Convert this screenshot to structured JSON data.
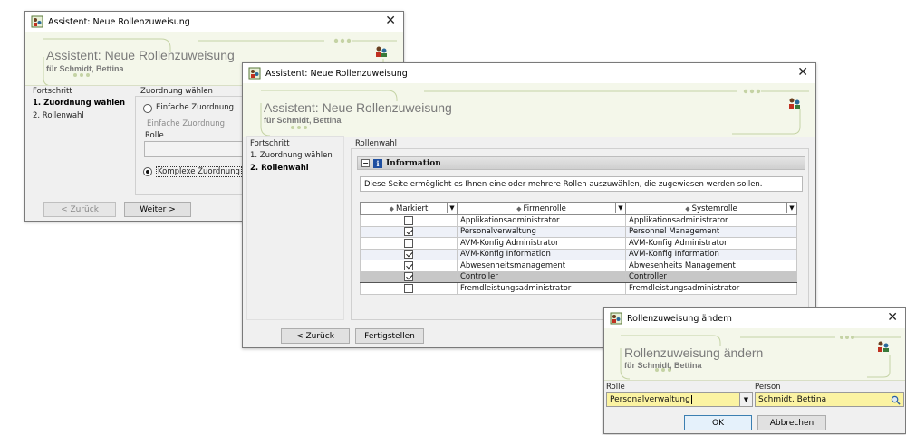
{
  "win1": {
    "title": "Assistent: Neue Rollenzuweisung",
    "banner_title": "Assistent: Neue Rollenzuweisung",
    "banner_subtitle": "für Schmidt, Bettina",
    "sidebar": {
      "title": "Fortschritt",
      "items": [
        {
          "label": "1. Zuordnung wählen"
        },
        {
          "label": "2. Rollenwahl"
        }
      ]
    },
    "group_title": "Zuordnung wählen",
    "radio_simple": "Einfache Zuordnung",
    "simple_group_title": "Einfache Zuordnung",
    "role_label": "Rolle",
    "radio_complex": "Komplexe Zuordnung",
    "back_button": "< Zurück",
    "next_button": "Weiter >"
  },
  "win2": {
    "title": "Assistent: Neue Rollenzuweisung",
    "banner_title": "Assistent: Neue Rollenzuweisung",
    "banner_subtitle": "für Schmidt, Bettina",
    "sidebar": {
      "title": "Fortschritt",
      "items": [
        {
          "label": "1. Zuordnung wählen"
        },
        {
          "label": "2. Rollenwahl"
        }
      ]
    },
    "section_title": "Rollenwahl",
    "info_header": "Information",
    "info_text": "Diese Seite ermöglicht es Ihnen eine oder mehrere Rollen auszuwählen, die zugewiesen werden sollen.",
    "table": {
      "columns": [
        "Markiert",
        "Firmenrolle",
        "Systemrolle"
      ],
      "rows": [
        {
          "checked": false,
          "firmenrolle": "Applikationsadministrator",
          "systemrolle": "Applikationsadministrator",
          "selected": false
        },
        {
          "checked": true,
          "firmenrolle": "Personalverwaltung",
          "systemrolle": "Personnel Management",
          "selected": false
        },
        {
          "checked": false,
          "firmenrolle": "AVM-Konfig Administrator",
          "systemrolle": "AVM-Konfig Administrator",
          "selected": false
        },
        {
          "checked": true,
          "firmenrolle": "AVM-Konfig Information",
          "systemrolle": "AVM-Konfig Information",
          "selected": false
        },
        {
          "checked": true,
          "firmenrolle": "Abwesenheitsmanagement",
          "systemrolle": "Abwesenheits Management",
          "selected": false
        },
        {
          "checked": true,
          "firmenrolle": "Controller",
          "systemrolle": "Controller",
          "selected": true
        },
        {
          "checked": false,
          "firmenrolle": "Fremdleistungsadministrator",
          "systemrolle": "Fremdleistungsadministrator",
          "selected": false
        }
      ]
    },
    "back_button": "< Zurück",
    "finish_button": "Fertigstellen"
  },
  "win3": {
    "title": "Rollenzuweisung ändern",
    "banner_title": "Rollenzuweisung ändern",
    "banner_subtitle": "für Schmidt, Bettina",
    "role_label": "Rolle",
    "role_value": "Personalverwaltung",
    "person_label": "Person",
    "person_value": "Schmidt, Bettina",
    "ok_button": "OK",
    "cancel_button": "Abbrechen"
  },
  "colors": {
    "banner_bg": "#f4f7ea",
    "input_highlight": "#fbf3a2",
    "selected_row": "#c7c7c7"
  }
}
